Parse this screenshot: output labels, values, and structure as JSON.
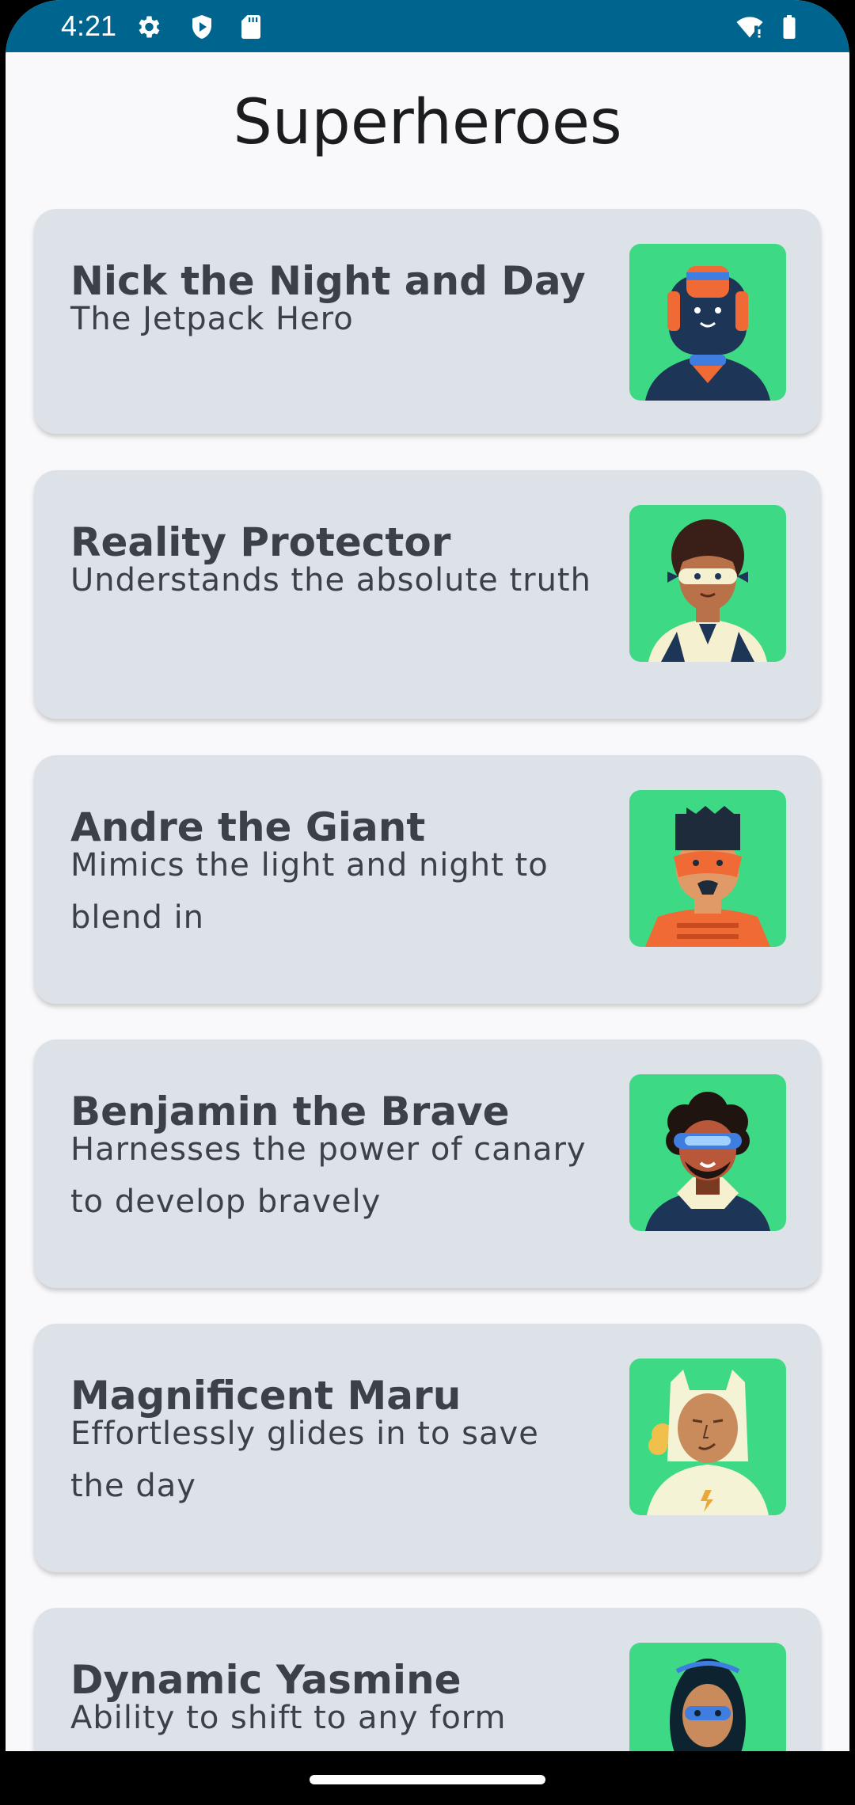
{
  "status_bar": {
    "time": "4:21",
    "left_icons": [
      "gear-icon",
      "play-shield-icon",
      "sd-card-icon"
    ],
    "right_icons": [
      "wifi-alert-icon",
      "battery-icon"
    ]
  },
  "app": {
    "title": "Superheroes"
  },
  "heroes": [
    {
      "name": "Nick the Night and Day",
      "description": "The Jetpack Hero",
      "avatar": "robot-hero-avatar"
    },
    {
      "name": "Reality Protector",
      "description": "Understands the absolute truth",
      "avatar": "masked-woman-avatar"
    },
    {
      "name": "Andre the Giant",
      "description": "Mimics the light and night to blend in",
      "avatar": "orange-mask-man-avatar"
    },
    {
      "name": "Benjamin the Brave",
      "description": "Harnesses the power of canary to develop bravely",
      "avatar": "curly-hair-goggles-avatar"
    },
    {
      "name": "Magnificent Maru",
      "description": "Effortlessly glides in to save the day",
      "avatar": "cat-hood-hero-avatar"
    },
    {
      "name": "Dynamic Yasmine",
      "description": "Ability to shift to any form",
      "avatar": "blue-mask-woman-avatar"
    }
  ],
  "colors": {
    "status_bar": "#00658e",
    "background": "#f9f9fb",
    "card": "#dde2e8",
    "avatar_bg": "#3dd984",
    "text": "#3c4149"
  }
}
